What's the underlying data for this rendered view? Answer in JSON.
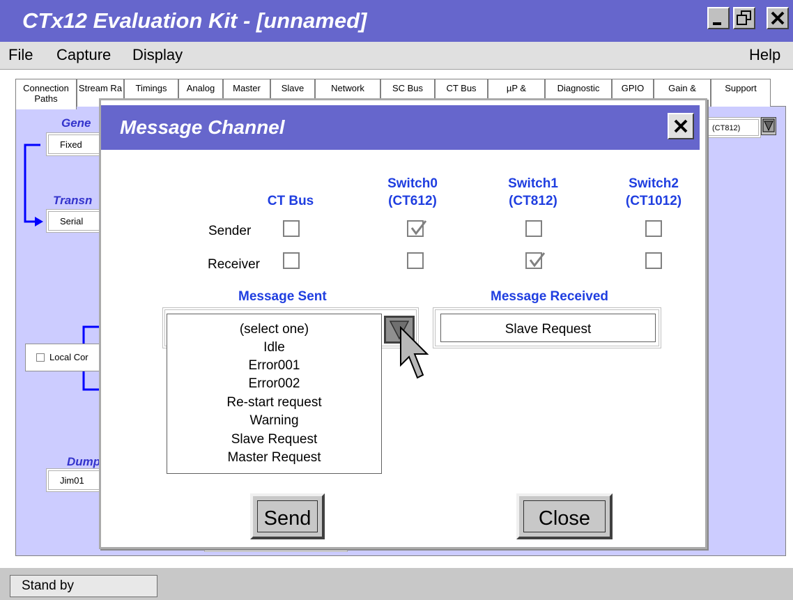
{
  "window": {
    "title": "CTx12 Evaluation Kit - [unnamed]"
  },
  "menu": {
    "items": [
      "File",
      "Capture",
      "Display"
    ],
    "help": "Help"
  },
  "tabs": [
    {
      "label": "Connection Paths",
      "active": true
    },
    {
      "label": "Stream Ra"
    },
    {
      "label": "Timings"
    },
    {
      "label": "Analog"
    },
    {
      "label": "Master"
    },
    {
      "label": "Slave"
    },
    {
      "label": "Network"
    },
    {
      "label": "SC Bus"
    },
    {
      "label": "CT Bus"
    },
    {
      "label": "µP &"
    },
    {
      "label": "Diagnostic"
    },
    {
      "label": "GPIO"
    },
    {
      "label": "Gain &"
    },
    {
      "label": "Support"
    }
  ],
  "background_panel": {
    "labels": [
      "Gene",
      "Transn",
      "Dump"
    ],
    "fields": [
      "Fixed",
      "Serial",
      "Jim01"
    ],
    "local_checkbox": "Local Cor",
    "right_select": "(CT812)"
  },
  "dialog": {
    "title": "Message Channel",
    "columns": [
      "CT Bus",
      "Switch0\n(CT612)",
      "Switch1\n(CT812)",
      "Switch2\n(CT1012)"
    ],
    "rows": [
      {
        "label": "Sender",
        "checked": [
          false,
          true,
          false,
          false
        ]
      },
      {
        "label": "Receiver",
        "checked": [
          false,
          false,
          true,
          false
        ]
      }
    ],
    "message_sent": {
      "label": "Message Sent",
      "options": [
        "(select one)",
        "Idle",
        "Error001",
        "Error002",
        "Re-start request",
        "Warning",
        "Slave Request",
        "Master Request"
      ]
    },
    "message_received": {
      "label": "Message Received",
      "value": "Slave Request"
    },
    "send_label": "Send",
    "close_label": "Close"
  },
  "status": {
    "text": "Stand by"
  },
  "colors": {
    "title_bar": "#6666cc",
    "panel": "#ccccff",
    "heading_blue": "#1f3ee0"
  }
}
